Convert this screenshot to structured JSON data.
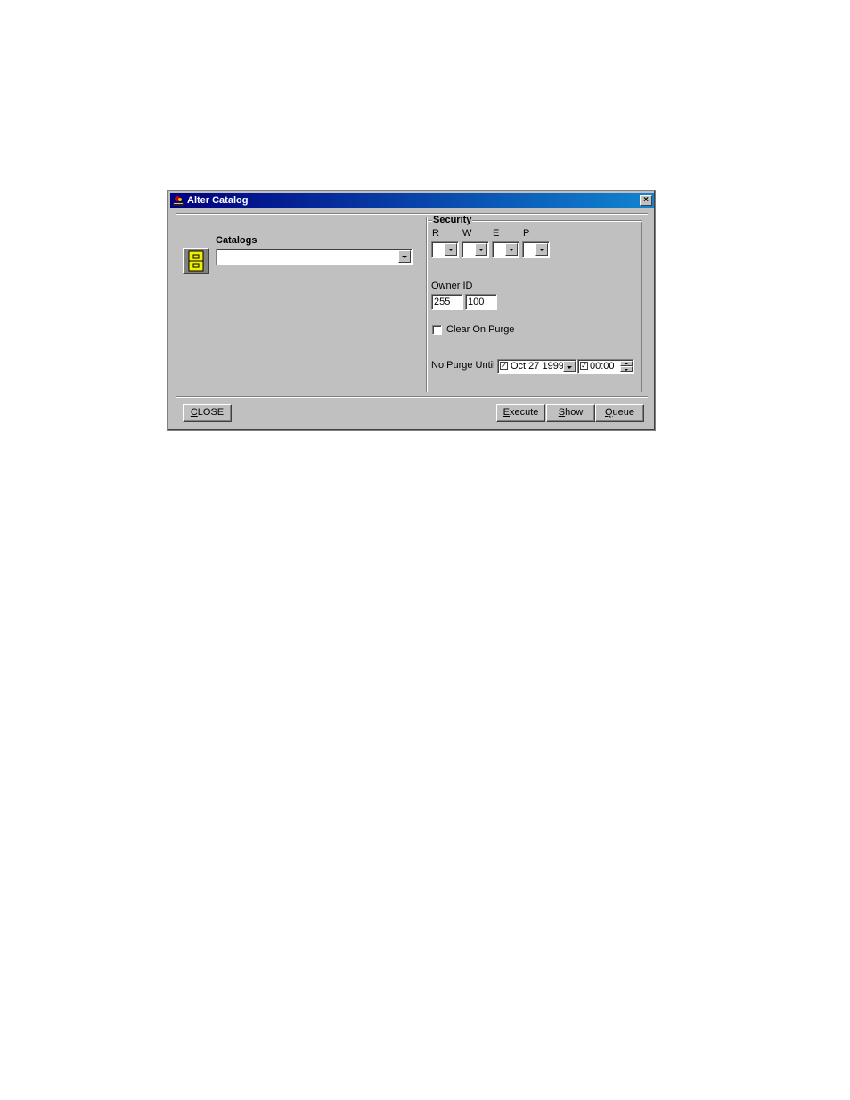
{
  "window": {
    "title": "Alter Catalog",
    "app_icon": "app-icon",
    "close_glyph": "×"
  },
  "catalogs": {
    "label": "Catalogs",
    "value": "",
    "icon": "file-cabinet-icon"
  },
  "security": {
    "group_label": "Security",
    "columns": [
      {
        "label": "R",
        "value": ""
      },
      {
        "label": "W",
        "value": ""
      },
      {
        "label": "E",
        "value": ""
      },
      {
        "label": "P",
        "value": ""
      }
    ]
  },
  "owner": {
    "label": "Owner ID",
    "field1": "255",
    "field2": "100"
  },
  "clear_on_purge": {
    "label": "Clear On Purge",
    "checked": false
  },
  "no_purge": {
    "label": "No Purge Until",
    "date": "Oct 27 1999",
    "time": "00:00",
    "date_checked": true,
    "time_checked": true,
    "check_glyph": "✓"
  },
  "buttons": {
    "close_hot": "C",
    "close_rest": "LOSE",
    "execute_hot": "E",
    "execute_rest": "xecute",
    "show_hot": "S",
    "show_rest": "how",
    "queue_hot": "Q",
    "queue_rest": "ueue"
  },
  "colors": {
    "face": "#c0c0c0",
    "title_start": "#000080",
    "title_end": "#1084d0",
    "icon_yellow": "#f0f000"
  }
}
